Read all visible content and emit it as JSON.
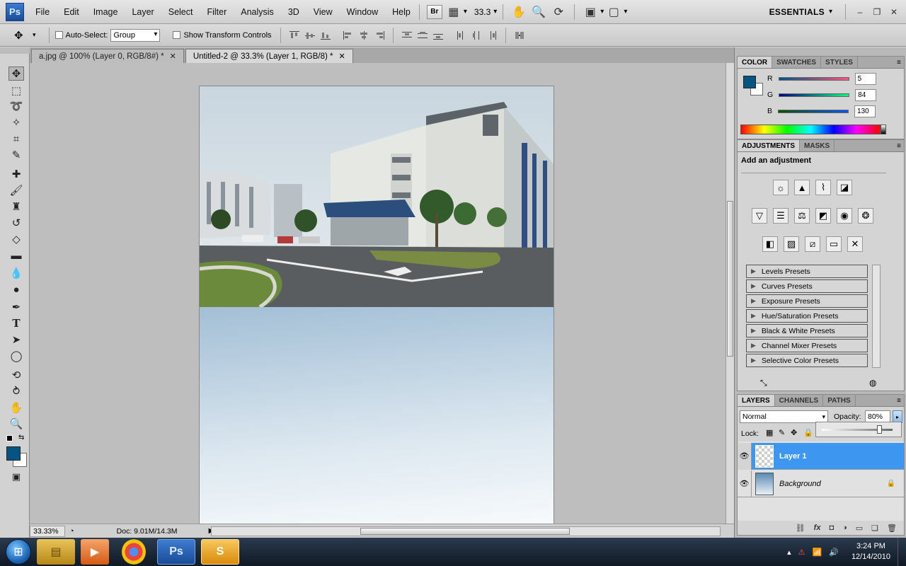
{
  "menubar": {
    "logo": "Ps",
    "items": [
      "File",
      "Edit",
      "Image",
      "Layer",
      "Select",
      "Filter",
      "Analysis",
      "3D",
      "View",
      "Window",
      "Help"
    ],
    "bridge_label": "Br",
    "zoom": "33.3",
    "workspace": "ESSENTIALS"
  },
  "options": {
    "auto_select_label": "Auto-Select:",
    "auto_select_value": "Group",
    "transform_label": "Show Transform Controls"
  },
  "tabs": [
    {
      "label": "a.jpg @ 100% (Layer 0, RGB/8#) *"
    },
    {
      "label": "Untitled-2 @ 33.3% (Layer 1, RGB/8) *"
    }
  ],
  "status": {
    "zoom": "33.33%",
    "doc": "Doc: 9.01M/14.3M"
  },
  "color_panel": {
    "tabs": [
      "COLOR",
      "SWATCHES",
      "STYLES"
    ],
    "r_label": "R",
    "r": "5",
    "g_label": "G",
    "g": "84",
    "b_label": "B",
    "b": "130",
    "fg_hex": "#055482"
  },
  "adjust_panel": {
    "tabs": [
      "ADJUSTMENTS",
      "MASKS"
    ],
    "title": "Add an adjustment",
    "presets": [
      "Levels Presets",
      "Curves Presets",
      "Exposure Presets",
      "Hue/Saturation Presets",
      "Black & White Presets",
      "Channel Mixer Presets",
      "Selective Color Presets"
    ]
  },
  "layers_panel": {
    "tabs": [
      "LAYERS",
      "CHANNELS",
      "PATHS"
    ],
    "blend_mode": "Normal",
    "opacity_label": "Opacity:",
    "opacity": "80%",
    "lock_label": "Lock:",
    "layers": [
      {
        "name": "Layer 1",
        "selected": true
      },
      {
        "name": "Background",
        "selected": false
      }
    ]
  },
  "taskbar": {
    "time": "3:24 PM",
    "date": "12/14/2010",
    "ps_label": "Ps"
  }
}
